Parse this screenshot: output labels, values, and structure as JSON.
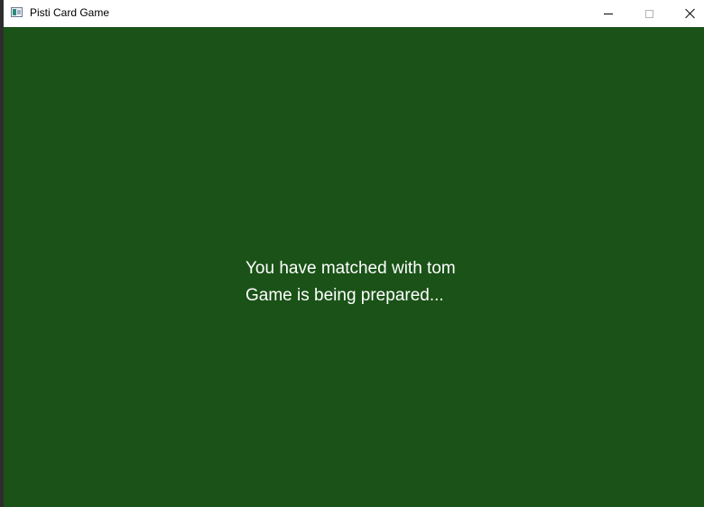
{
  "window": {
    "title": "Pisti Card Game",
    "controls": [
      "minimize-icon",
      "maximize-icon",
      "close-icon"
    ]
  },
  "colors": {
    "table_background": "#1a5217",
    "titlebar": "#ffffff",
    "message_text": "#ffffff"
  },
  "status": {
    "match_line": "You have matched with tom",
    "prep_line": "Game is being prepared..."
  }
}
